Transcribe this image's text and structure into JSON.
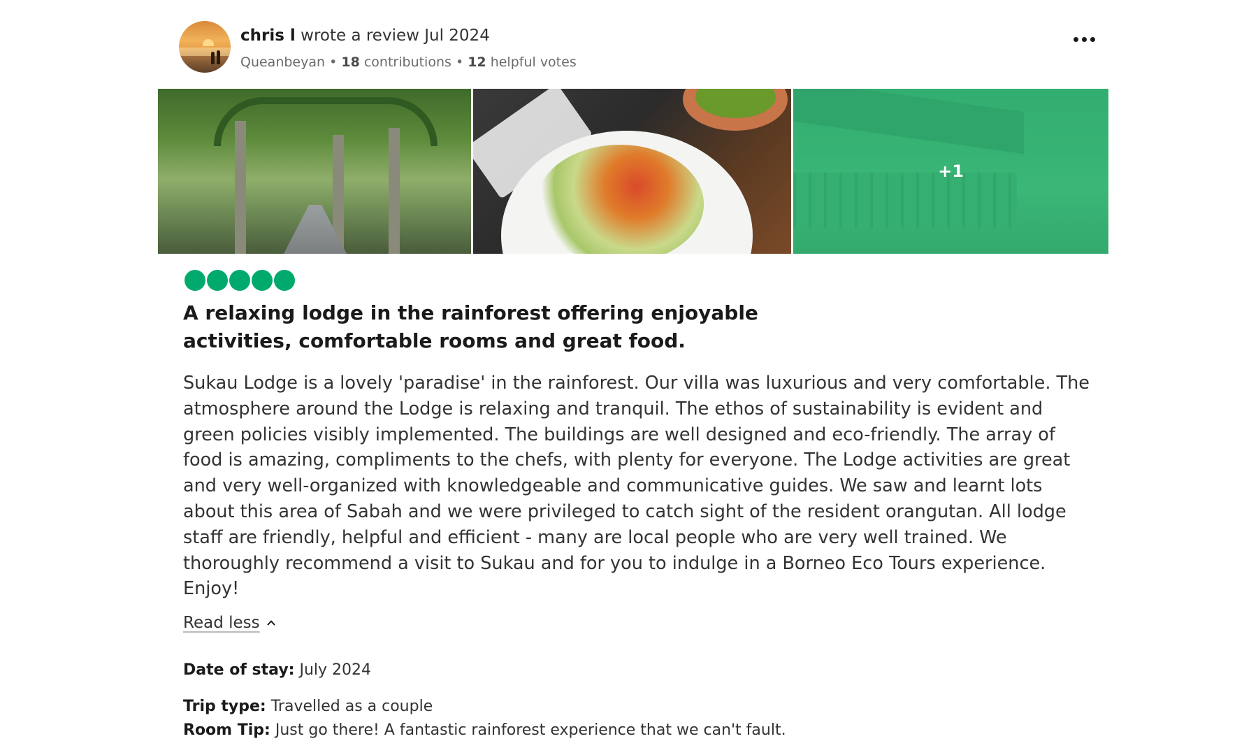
{
  "review": {
    "author": {
      "name": "chris l",
      "action": " wrote a review Jul 2024",
      "location": "Queanbeyan",
      "separator": " • ",
      "contributions_count": "18",
      "contributions_label": " contributions",
      "helpful_count": "12",
      "helpful_label": " helpful votes"
    },
    "photos": {
      "extra_count": "+1"
    },
    "rating": {
      "value": 5,
      "max": 5,
      "color": "#00aa6c"
    },
    "title": "A relaxing lodge in the rainforest offering enjoyable activities, comfortable rooms and great food.",
    "body": "Sukau Lodge is a lovely 'paradise' in the rainforest. Our villa was luxurious and very comfortable. The atmosphere around the Lodge is relaxing and tranquil. The ethos of sustainability is evident and green policies visibly implemented. The buildings are well designed and eco-friendly. The array of food is amazing, compliments to the chefs, with plenty for everyone. The Lodge activities are great and very well-organized with knowledgeable and communicative guides. We saw and learnt lots about this area of Sabah and we were privileged to catch sight of the resident orangutan. All lodge staff are friendly, helpful and efficient - many are local people who are very well trained. We thoroughly recommend a visit to Sukau and for you to indulge in a Borneo Eco Tours experience. Enjoy!",
    "read_less_label": "Read less",
    "details": {
      "date_label": "Date of stay:",
      "date_value": " July 2024",
      "trip_label": "Trip type:",
      "trip_value": " Travelled as a couple",
      "tip_label": "Room Tip:",
      "tip_value": " Just go there! A fantastic rainforest experience that we can't fault."
    }
  },
  "icons": {
    "more_options": "more-horizontal-icon",
    "read_less": "chevron-up-icon"
  },
  "colors": {
    "accent_green": "#00aa6c",
    "photo_overlay": "#34c882"
  }
}
